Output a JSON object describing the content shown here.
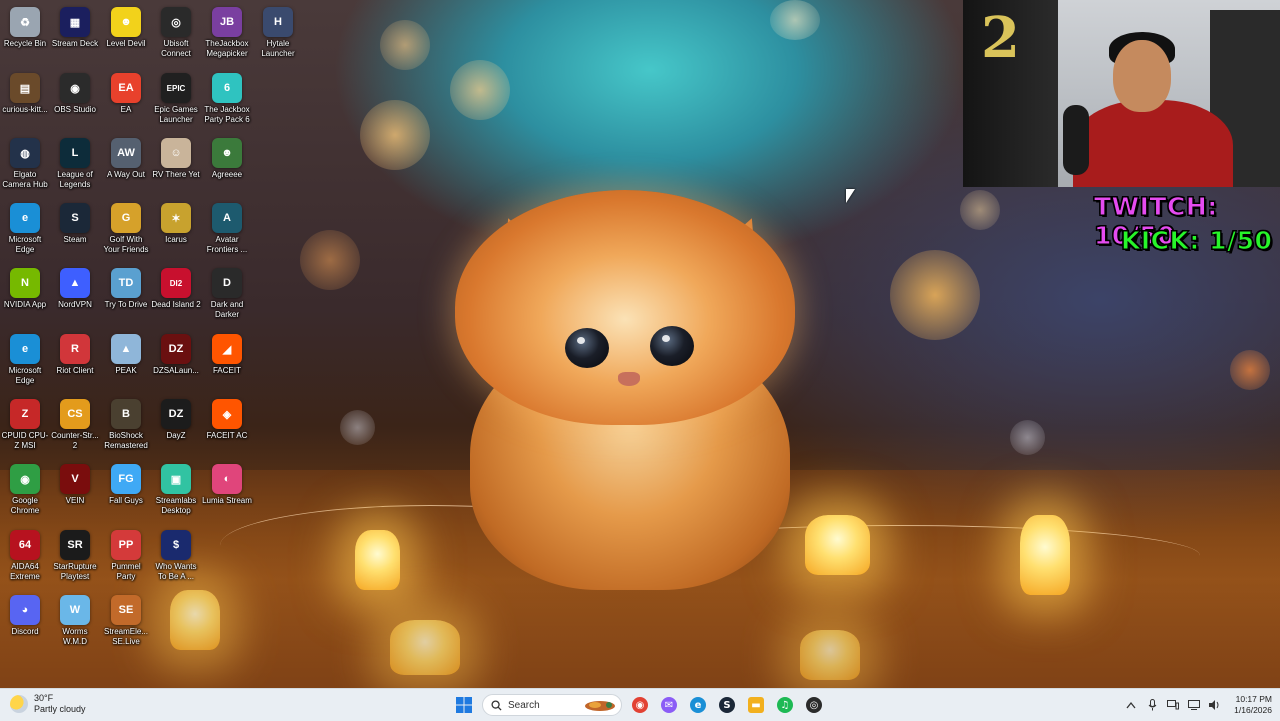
{
  "desktop": {
    "icons": [
      {
        "label": "Recycle Bin",
        "icon": "recycle-bin-icon",
        "glyph": "♻",
        "color": "#9aa5b1"
      },
      {
        "label": "Stream Deck",
        "icon": "stream-deck-icon",
        "glyph": "▦",
        "color": "#1b1f5e"
      },
      {
        "label": "Level Devil",
        "icon": "level-devil-icon",
        "glyph": "☻",
        "color": "#f2d21b"
      },
      {
        "label": "Ubisoft Connect",
        "icon": "ubisoft-icon",
        "glyph": "◎",
        "color": "#2a2a2a"
      },
      {
        "label": "TheJackbox Megapicker",
        "icon": "jackbox-megapicker-icon",
        "glyph": "JB",
        "color": "#7a3fa0"
      },
      {
        "label": "Hytale Launcher",
        "icon": "hytale-icon",
        "glyph": "H",
        "color": "#3a4a6e"
      },
      {
        "label": "curious-kitt...",
        "icon": "shortcut-icon",
        "glyph": "▤",
        "color": "#6a4a2a"
      },
      {
        "label": "OBS Studio",
        "icon": "obs-icon",
        "glyph": "◉",
        "color": "#2b2b2b"
      },
      {
        "label": "EA",
        "icon": "ea-icon",
        "glyph": "EA",
        "color": "#e8412c"
      },
      {
        "label": "Epic Games Launcher",
        "icon": "epic-games-icon",
        "glyph": "EPIC",
        "color": "#202020"
      },
      {
        "label": "The Jackbox Party Pack 6",
        "icon": "jackbox-pack-icon",
        "glyph": "6",
        "color": "#2fc3c0"
      },
      {
        "label": "Elgato Camera Hub",
        "icon": "camera-hub-icon",
        "glyph": "◍",
        "color": "#23324a"
      },
      {
        "label": "League of Legends",
        "icon": "league-icon",
        "glyph": "L",
        "color": "#0d2c3a"
      },
      {
        "label": "A Way Out",
        "icon": "a-way-out-icon",
        "glyph": "AW",
        "color": "#556070"
      },
      {
        "label": "RV There Yet",
        "icon": "rv-there-yet-icon",
        "glyph": "☺",
        "color": "#c9b49a"
      },
      {
        "label": "Agreeee",
        "icon": "agreeee-icon",
        "glyph": "☻",
        "color": "#3b7a3b"
      },
      {
        "label": "Microsoft Edge",
        "icon": "edge-icon",
        "glyph": "e",
        "color": "#1a8fd6"
      },
      {
        "label": "Steam",
        "icon": "steam-icon",
        "glyph": "S",
        "color": "#1b2838"
      },
      {
        "label": "Golf With Your Friends",
        "icon": "golf-icon",
        "glyph": "G",
        "color": "#d6a12a"
      },
      {
        "label": "Icarus",
        "icon": "icarus-icon",
        "glyph": "✶",
        "color": "#c8a22e"
      },
      {
        "label": "Avatar Frontiers ...",
        "icon": "avatar-icon",
        "glyph": "A",
        "color": "#1d5a6e"
      },
      {
        "label": "NVIDIA App",
        "icon": "nvidia-icon",
        "glyph": "N",
        "color": "#76b900"
      },
      {
        "label": "NordVPN",
        "icon": "nordvpn-icon",
        "glyph": "▲",
        "color": "#3e5fff"
      },
      {
        "label": "Try To Drive",
        "icon": "try-to-drive-icon",
        "glyph": "TD",
        "color": "#5aa0d0"
      },
      {
        "label": "Dead Island 2",
        "icon": "dead-island-icon",
        "glyph": "DI2",
        "color": "#c8102e"
      },
      {
        "label": "Dark and Darker",
        "icon": "dark-darker-icon",
        "glyph": "D",
        "color": "#2a2a2a"
      },
      {
        "label": "Microsoft Edge",
        "icon": "edge-icon",
        "glyph": "e",
        "color": "#1a8fd6"
      },
      {
        "label": "Riot Client",
        "icon": "riot-icon",
        "glyph": "R",
        "color": "#d1363a"
      },
      {
        "label": "PEAK",
        "icon": "peak-icon",
        "glyph": "▲",
        "color": "#8fb6d9"
      },
      {
        "label": "DZSALaun...",
        "icon": "dzsa-icon",
        "glyph": "DZ",
        "color": "#6a1010"
      },
      {
        "label": "FACEIT",
        "icon": "faceit-icon",
        "glyph": "◢",
        "color": "#ff5500"
      },
      {
        "label": "CPUID CPU-Z MSI",
        "icon": "cpuz-icon",
        "glyph": "Z",
        "color": "#c62828"
      },
      {
        "label": "Counter-Str... 2",
        "icon": "cs2-icon",
        "glyph": "CS",
        "color": "#e39b1c"
      },
      {
        "label": "BioShock Remastered",
        "icon": "bioshock-icon",
        "glyph": "B",
        "color": "#4a4030"
      },
      {
        "label": "DayZ",
        "icon": "dayz-icon",
        "glyph": "DZ",
        "color": "#1c1c1c"
      },
      {
        "label": "FACEIT AC",
        "icon": "faceit-ac-icon",
        "glyph": "◈",
        "color": "#ff5500"
      },
      {
        "label": "Google Chrome",
        "icon": "chrome-icon",
        "glyph": "◉",
        "color": "#2f9e44"
      },
      {
        "label": "VEIN",
        "icon": "vein-icon",
        "glyph": "V",
        "color": "#7a0d0d"
      },
      {
        "label": "Fall Guys",
        "icon": "fall-guys-icon",
        "glyph": "FG",
        "color": "#3fa9f5"
      },
      {
        "label": "Streamlabs Desktop",
        "icon": "streamlabs-icon",
        "glyph": "▣",
        "color": "#31c3a2"
      },
      {
        "label": "Lumia Stream",
        "icon": "lumia-icon",
        "glyph": "◐",
        "color": "#e0457b"
      },
      {
        "label": "AIDA64 Extreme",
        "icon": "aida64-icon",
        "glyph": "64",
        "color": "#b7121f"
      },
      {
        "label": "StarRupture Playtest",
        "icon": "starrupture-icon",
        "glyph": "SR",
        "color": "#1b1b1b"
      },
      {
        "label": "Pummel Party",
        "icon": "pummel-party-icon",
        "glyph": "PP",
        "color": "#d43a3a"
      },
      {
        "label": "Who Wants To Be A ...",
        "icon": "millionaire-icon",
        "glyph": "$",
        "color": "#1a2a6e"
      },
      {
        "label": "Discord",
        "icon": "discord-icon",
        "glyph": "◕",
        "color": "#5865f2"
      },
      {
        "label": "Worms W.M.D",
        "icon": "worms-icon",
        "glyph": "W",
        "color": "#6ab7e8"
      },
      {
        "label": "StreamEle... SE.Live",
        "icon": "streamelements-icon",
        "glyph": "SE",
        "color": "#c26a2a"
      }
    ]
  },
  "overlay": {
    "twitch": "TWITCH: 10/50",
    "kick": "KICK: 1/50",
    "twitch_color": "#e54bf0",
    "kick_color": "#27f52a"
  },
  "taskbar": {
    "weather_temp": "30°F",
    "weather_desc": "Partly cloudy",
    "search_placeholder": "Search",
    "time": "10:17 PM",
    "date": "1/16/2026",
    "pinned": [
      {
        "name": "start-button",
        "icon": "windows-icon",
        "color": "#1f7ae0"
      },
      {
        "name": "chrome-button",
        "icon": "chrome-icon",
        "color": "#e24133"
      },
      {
        "name": "messenger-button",
        "icon": "messenger-icon",
        "color": "#8b5cf6"
      },
      {
        "name": "edge-button",
        "icon": "edge-icon",
        "color": "#1a8fd6"
      },
      {
        "name": "steam-button",
        "icon": "steam-icon",
        "color": "#1b2838"
      },
      {
        "name": "file-explorer-button",
        "icon": "folder-icon",
        "color": "#f2b01e"
      },
      {
        "name": "spotify-button",
        "icon": "spotify-icon",
        "color": "#1db954"
      },
      {
        "name": "obs-button",
        "icon": "obs-icon",
        "color": "#2b2b2b"
      }
    ]
  }
}
